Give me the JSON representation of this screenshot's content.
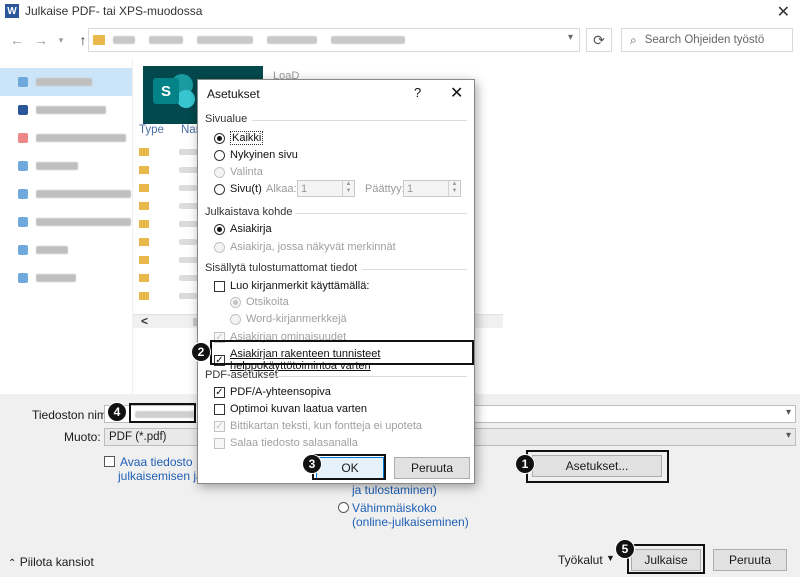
{
  "window": {
    "title": "Julkaise PDF- tai XPS-muodossa",
    "app_icon": "W",
    "search_placeholder": "Search Ohjeiden työstö"
  },
  "file_area": {
    "type_header": "Type",
    "name_header": "Nar",
    "loan_text": "LoaD"
  },
  "bottom": {
    "filename_label": "Tiedoston nimi:",
    "type_label": "Muoto:",
    "type_value": "PDF (*.pdf)",
    "open_after_line1": "Avaa tiedosto",
    "open_after_line2": "julkaisemisen jälk",
    "optimize_standard_line2": "ja tulostaminen)",
    "optimize_min_line1": "Vähimmäiskoko",
    "optimize_min_line2": "(online-julkaiseminen)",
    "options_button": "Asetukset...",
    "tools_label": "Työkalut",
    "publish_button": "Julkaise",
    "cancel_button": "Peruuta",
    "hide_folders": "Piilota kansiot"
  },
  "dialog": {
    "title": "Asetukset",
    "help": "?",
    "close": "✕",
    "page_range_group": "Sivualue",
    "opt_all": "Kaikki",
    "opt_current": "Nykyinen sivu",
    "opt_selection": "Valinta",
    "opt_pages": "Sivu(t)",
    "from_label": "Alkaa:",
    "from_value": "1",
    "to_label": "Päättyy:",
    "to_value": "1",
    "publish_what_group": "Julkaistava kohde",
    "opt_document": "Asiakirja",
    "opt_document_markup": "Asiakirja, jossa näkyvät merkinnät",
    "nonprint_group": "Sisällytä tulostumattomat tiedot",
    "create_bookmarks": "Luo kirjanmerkit käyttämällä:",
    "bm_headings": "Otsikoita",
    "bm_word": "Word-kirjanmerkkejä",
    "doc_properties": "Asiakirjan ominaisuudet",
    "structure_tags": "Asiakirjan rakenteen tunnisteet helppokäyttötoimintoa varten",
    "pdf_group": "PDF-asetukset",
    "pdfa": "PDF/A-yhteensopiva",
    "optimize_image": "Optimoi kuvan laatua varten",
    "bitmap_text": "Bittikartan teksti, kun fontteja ei upoteta",
    "encrypt": "Salaa tiedosto salasanalla",
    "ok": "OK",
    "cancel": "Peruuta"
  },
  "callouts": [
    "1",
    "2",
    "3",
    "4",
    "5"
  ],
  "colors": {
    "accent_link": "#1f5fb5",
    "selection": "#cce4f7",
    "sharepoint": "#038387"
  }
}
